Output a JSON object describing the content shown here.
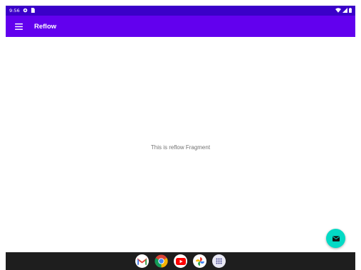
{
  "status_bar": {
    "time": "9:56",
    "icons": [
      "settings-gear-icon",
      "sim-card-icon",
      "wifi-icon",
      "signal-icon",
      "battery-icon"
    ]
  },
  "app_bar": {
    "title": "Reflow",
    "menu_icon": "hamburger-menu-icon",
    "background": "#6200ee",
    "status_background": "#3a00c8"
  },
  "content": {
    "message": "This is reflow Fragment"
  },
  "fab": {
    "icon": "email-icon",
    "color": "#03dac5"
  },
  "dock": {
    "apps": [
      "gmail",
      "chrome",
      "youtube",
      "photos",
      "app-drawer"
    ]
  }
}
